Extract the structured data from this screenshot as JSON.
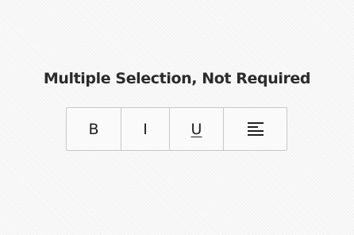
{
  "title": "Multiple Selection, Not Required",
  "toggle_group": {
    "buttons": [
      {
        "label": "B",
        "icon": "bold"
      },
      {
        "label": "I",
        "icon": "italic"
      },
      {
        "label": "U",
        "icon": "underline"
      },
      {
        "label": "",
        "icon": "align-left-icon"
      }
    ]
  }
}
